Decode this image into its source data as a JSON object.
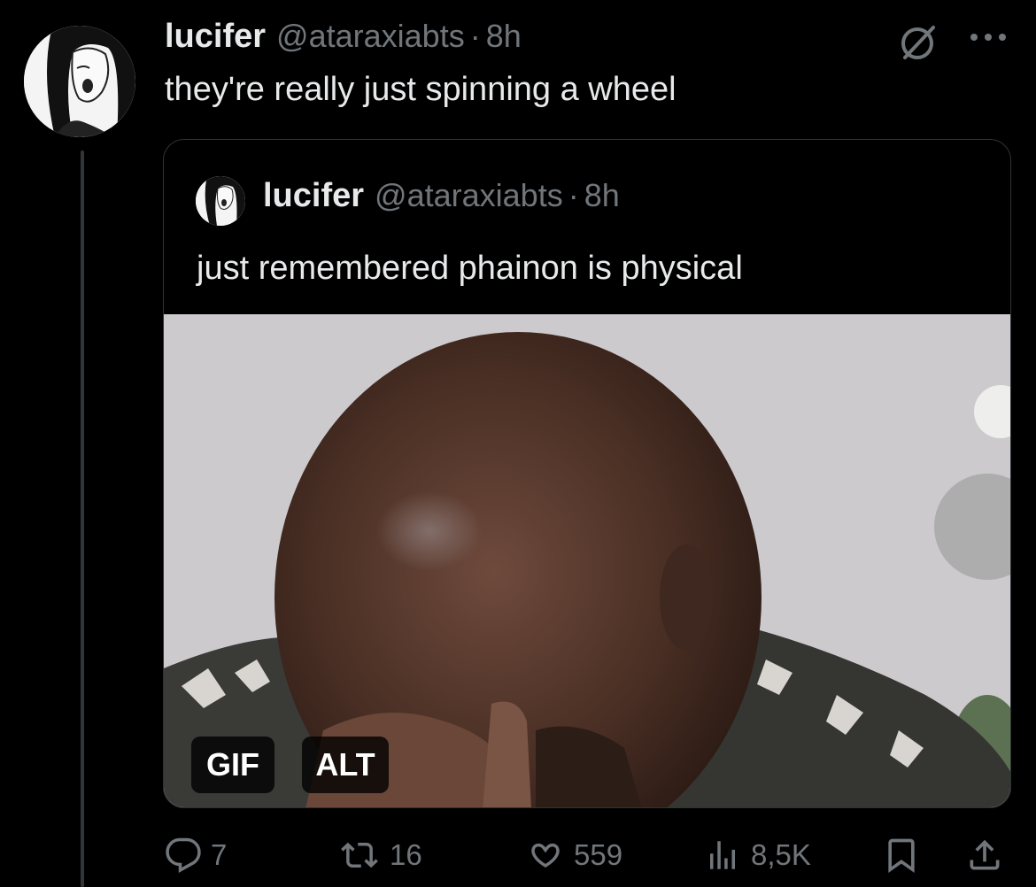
{
  "tweet": {
    "author_name": "lucifer",
    "author_handle": "@ataraxiabts",
    "separator": "·",
    "time": "8h",
    "text": "they're really just spinning a wheel"
  },
  "quote": {
    "author_name": "lucifer",
    "author_handle": "@ataraxiabts",
    "separator": "·",
    "time": "8h",
    "text": "just remembered phainon is physical",
    "media": {
      "type": "gif",
      "gif_badge": "GIF",
      "alt_badge": "ALT"
    }
  },
  "actions": {
    "replies": "7",
    "reposts": "16",
    "likes": "559",
    "views": "8,5K"
  },
  "icons": {
    "grok": "grok-icon",
    "more": "more-icon",
    "reply": "reply-icon",
    "repost": "repost-icon",
    "like": "heart-icon",
    "views": "views-icon",
    "bookmark": "bookmark-icon",
    "share": "share-icon"
  },
  "colors": {
    "background": "#000000",
    "text_primary": "#e7e9ea",
    "text_secondary": "#71767b",
    "border": "#2f3336"
  }
}
